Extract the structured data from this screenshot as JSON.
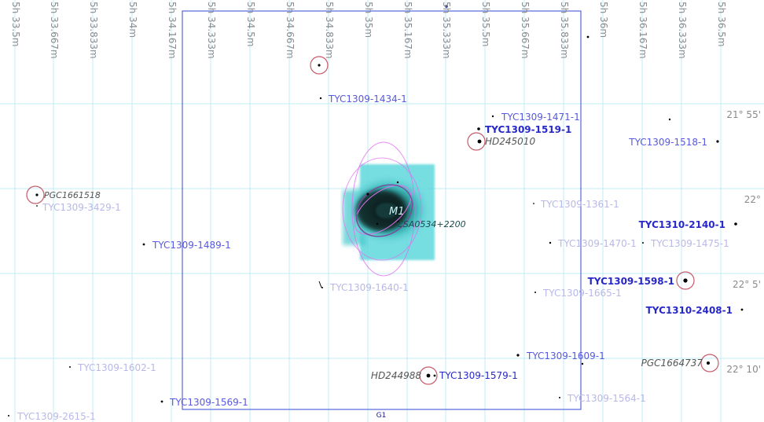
{
  "colors": {
    "grid": "#bfeef5",
    "fov": "#5566dd",
    "label_bright": "#2828c8",
    "label_mid": "#5858e0",
    "label_faint": "#b8b8ea",
    "galaxy_circle": "#c85a6a",
    "galaxy_label": "#555555",
    "nebula": "#2ec8cc"
  },
  "ra_labels": [
    "5h 33.5m",
    "5h 33.667m",
    "5h 33.833m",
    "5h 34m",
    "5h 34.167m",
    "5h 34.333m",
    "5h 34.5m",
    "5h 34.667m",
    "5h 34.833m",
    "5h 35m",
    "5h 35.167m",
    "5h 35.333m",
    "5h 35.5m",
    "5h 35.667m",
    "5h 35.833m",
    "5h 36m",
    "5h 36.167m",
    "5h 36.333m",
    "5h 36.5m"
  ],
  "dec_labels": [
    "21° 55'",
    "22°",
    "22° 5'",
    "22° 10'"
  ],
  "fov": {
    "label": "G1"
  },
  "nebula": {
    "name": "M1",
    "alt_name": "CSA0534+2200"
  },
  "stars": [
    {
      "label": "TYC1309-1434-1",
      "tone": "mid"
    },
    {
      "label": "TYC1309-1471-1",
      "tone": "mid"
    },
    {
      "label": "TYC1309-1519-1",
      "tone": "bright"
    },
    {
      "label": "TYC1309-1518-1",
      "tone": "mid"
    },
    {
      "label": "TYC1309-3429-1",
      "tone": "faint"
    },
    {
      "label": "TYC1309-1361-1",
      "tone": "faint"
    },
    {
      "label": "TYC1310-2140-1",
      "tone": "bright"
    },
    {
      "label": "TYC1309-1489-1",
      "tone": "mid"
    },
    {
      "label": "TYC1309-1470-1",
      "tone": "faint"
    },
    {
      "label": "TYC1309-1475-1",
      "tone": "faint"
    },
    {
      "label": "TYC1309-1598-1",
      "tone": "bright"
    },
    {
      "label": "TYC1309-1640-1",
      "tone": "faint"
    },
    {
      "label": "TYC1309-1665-1",
      "tone": "faint"
    },
    {
      "label": "TYC1310-2408-1",
      "tone": "bright"
    },
    {
      "label": "TYC1309-1609-1",
      "tone": "mid"
    },
    {
      "label": "TYC1309-1602-1",
      "tone": "faint"
    },
    {
      "label": "TYC1309-1579-1",
      "tone": "bright"
    },
    {
      "label": "TYC1309-1569-1",
      "tone": "mid"
    },
    {
      "label": "TYC1309-1564-1",
      "tone": "faint"
    },
    {
      "label": "TYC1309-2615-1",
      "tone": "faint"
    }
  ],
  "galaxies": [
    {
      "label": "PGC1661518"
    },
    {
      "label": "HD245010"
    },
    {
      "label": "HD244988"
    },
    {
      "label": "PGC1664737"
    }
  ]
}
